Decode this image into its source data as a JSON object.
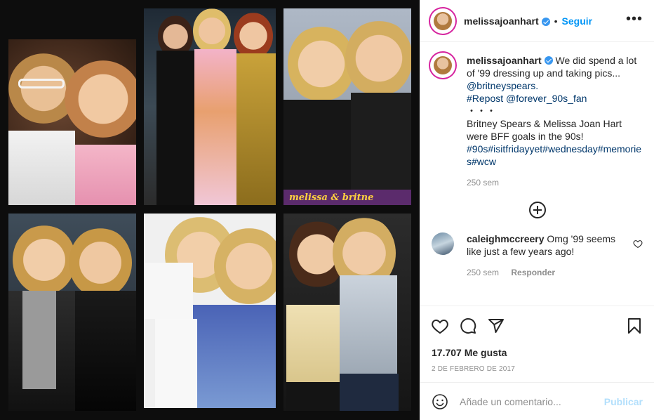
{
  "post": {
    "username": "melissajoanhart",
    "follow_label": "Seguir",
    "more_label": "•••"
  },
  "caption": {
    "username": "melissajoanhart",
    "line1": "We did spend a lot of '99 dressing up and taking pics...",
    "mention": "@britneyspears.",
    "repost": "#Repost @forever_90s_fan",
    "dots": "・・・",
    "body": "Britney Spears & Melissa Joan Hart were BFF goals in the 90s!",
    "hashtags": "#90s#isitfridayyet#wednesday#memories#wcw",
    "time": "250 sem"
  },
  "comment": {
    "username": "caleighmccreery",
    "text": "Omg '99 seems like just a few years ago!",
    "time": "250 sem",
    "reply_label": "Responder"
  },
  "stats": {
    "likes": "17.707 Me gusta",
    "date": "2 de febrero de 2017"
  },
  "composer": {
    "placeholder": "Añade un comentario...",
    "post_label": "Publicar"
  },
  "collage": {
    "caption_strip": "melissa & britne"
  }
}
